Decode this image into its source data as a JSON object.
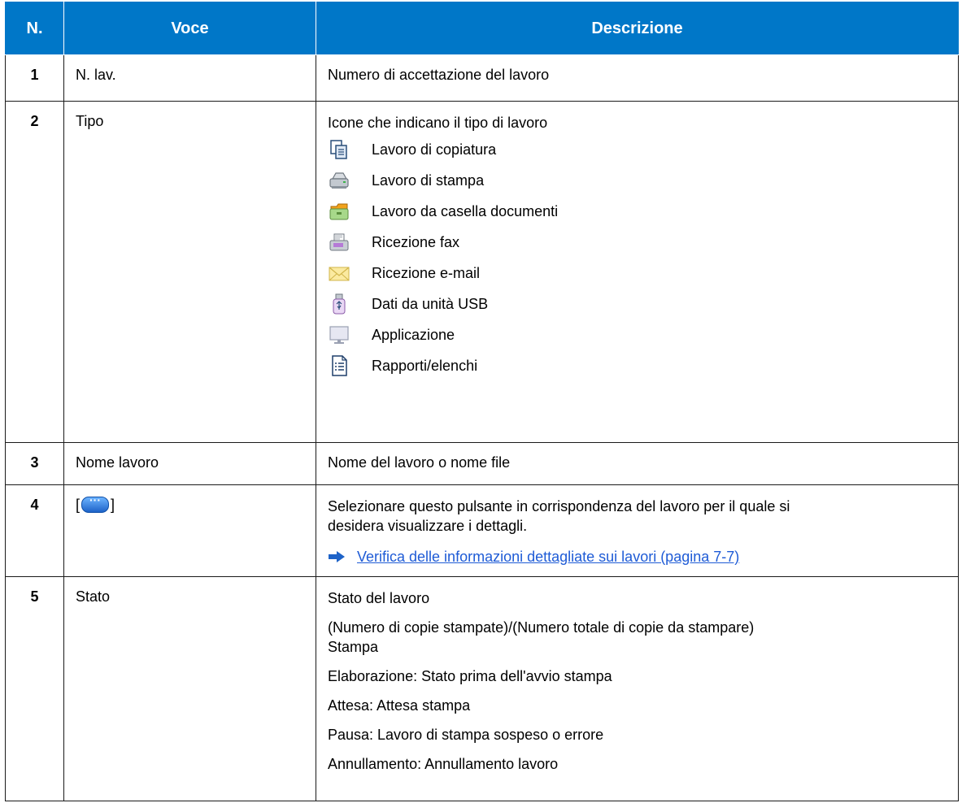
{
  "header": {
    "col_n": "N.",
    "col_voce": "Voce",
    "col_desc": "Descrizione"
  },
  "rows": [
    {
      "n": "1",
      "voce": "N. lav.",
      "desc": "Numero di accettazione del lavoro"
    },
    {
      "n": "2",
      "voce": "Tipo",
      "desc": "Icone che indicano il tipo di lavoro",
      "icons": [
        {
          "icon": "copy-job-icon",
          "label": "Lavoro di copiatura"
        },
        {
          "icon": "print-job-icon",
          "label": "Lavoro di stampa"
        },
        {
          "icon": "document-box-icon",
          "label": "Lavoro da casella documenti"
        },
        {
          "icon": "fax-icon",
          "label": "Ricezione fax"
        },
        {
          "icon": "email-icon",
          "label": "Ricezione e-mail"
        },
        {
          "icon": "usb-drive-icon",
          "label": "Dati da unità USB"
        },
        {
          "icon": "monitor-icon",
          "label": "Applicazione"
        },
        {
          "icon": "report-list-icon",
          "label": "Rapporti/elenchi"
        }
      ]
    },
    {
      "n": "3",
      "voce": "Nome lavoro",
      "desc": "Nome del lavoro o nome file"
    },
    {
      "n": "4",
      "voce_prefix": "[",
      "voce_suffix": "]",
      "desc_line1": "Selezionare questo pulsante in corrispondenza del lavoro per il quale si",
      "desc_line2": "desidera visualizzare i dettagli.",
      "link": "Verifica delle informazioni dettagliate sui lavori (pagina 7-7)"
    },
    {
      "n": "5",
      "voce": "Stato",
      "lines": [
        "Stato del lavoro",
        "(Numero di copie stampate)/(Numero totale di copie da stampare)",
        "Stampa",
        "Elaborazione: Stato prima dell'avvio stampa",
        "Attesa: Attesa stampa",
        "Pausa: Lavoro di stampa sospeso o errore",
        "Annullamento: Annullamento lavoro"
      ]
    }
  ],
  "colors": {
    "header_bg": "#0077c8",
    "link": "#1e5bd6"
  }
}
